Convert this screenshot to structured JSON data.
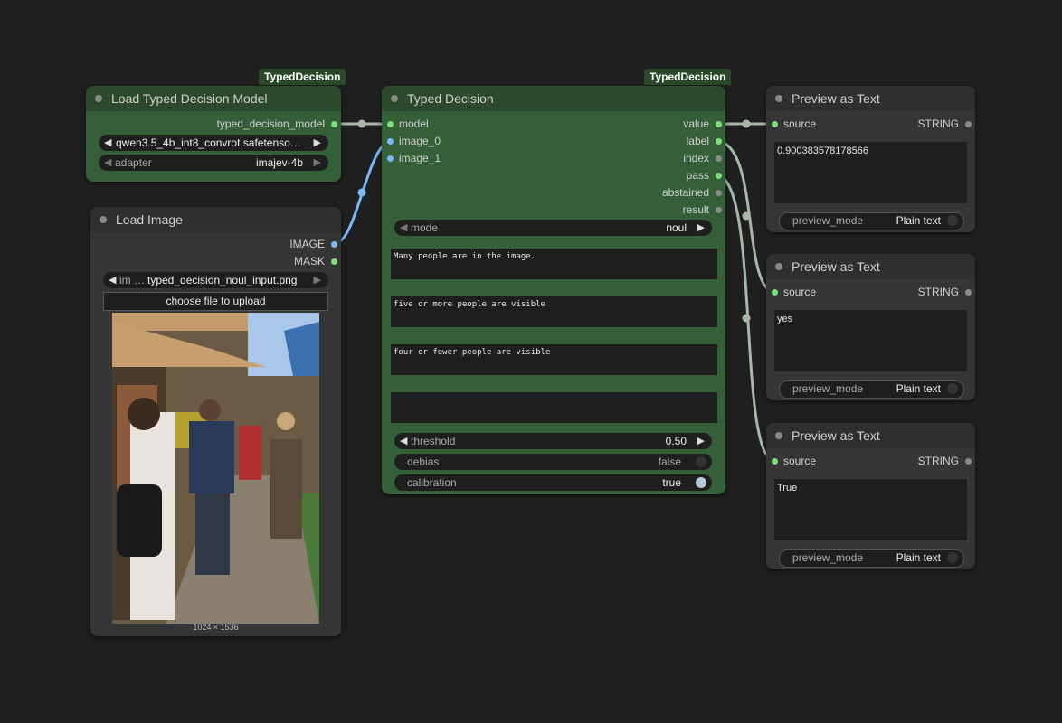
{
  "load_model": {
    "badge": "TypedDecision",
    "title": "Load Typed Decision Model",
    "output_label": "typed_decision_model",
    "model_value": "qwen3.5_4b_int8_convrot.safetenso…",
    "adapter_label": "adapter",
    "adapter_value": "imajev-4b"
  },
  "load_image": {
    "title": "Load Image",
    "output_image": "IMAGE",
    "output_mask": "MASK",
    "image_label": "im …",
    "image_value": "typed_decision_noul_input.png",
    "upload_label": "choose file to upload",
    "dimensions": "1024 × 1536"
  },
  "typed_decision": {
    "badge": "TypedDecision",
    "title": "Typed Decision",
    "inputs": [
      "model",
      "image_0",
      "image_1"
    ],
    "outputs": [
      "value",
      "label",
      "index",
      "pass",
      "abstained",
      "result"
    ],
    "mode_label": "mode",
    "mode_value": "noul",
    "prompt_1": "Many people are in the image.",
    "prompt_2": "five or more people are visible",
    "prompt_3": "four or fewer people are visible",
    "prompt_4": "",
    "threshold_label": "threshold",
    "threshold_value": "0.50",
    "debias_label": "debias",
    "debias_value": "false",
    "calibration_label": "calibration",
    "calibration_value": "true"
  },
  "preview_1": {
    "title": "Preview as Text",
    "input_label": "source",
    "output_label": "STRING",
    "text": "0.900383578178566",
    "mode_label": "preview_mode",
    "mode_value": "Plain text"
  },
  "preview_2": {
    "title": "Preview as Text",
    "input_label": "source",
    "output_label": "STRING",
    "text": "yes",
    "mode_label": "preview_mode",
    "mode_value": "Plain text"
  },
  "preview_3": {
    "title": "Preview as Text",
    "input_label": "source",
    "output_label": "STRING",
    "text": "True",
    "mode_label": "preview_mode",
    "mode_value": "Plain text"
  },
  "colors": {
    "canvas": "#1f1f1f",
    "green_node": "#355f36",
    "gray_node": "#353535",
    "wire": "#a8b8a8",
    "image_wire": "#7ab8f5"
  }
}
